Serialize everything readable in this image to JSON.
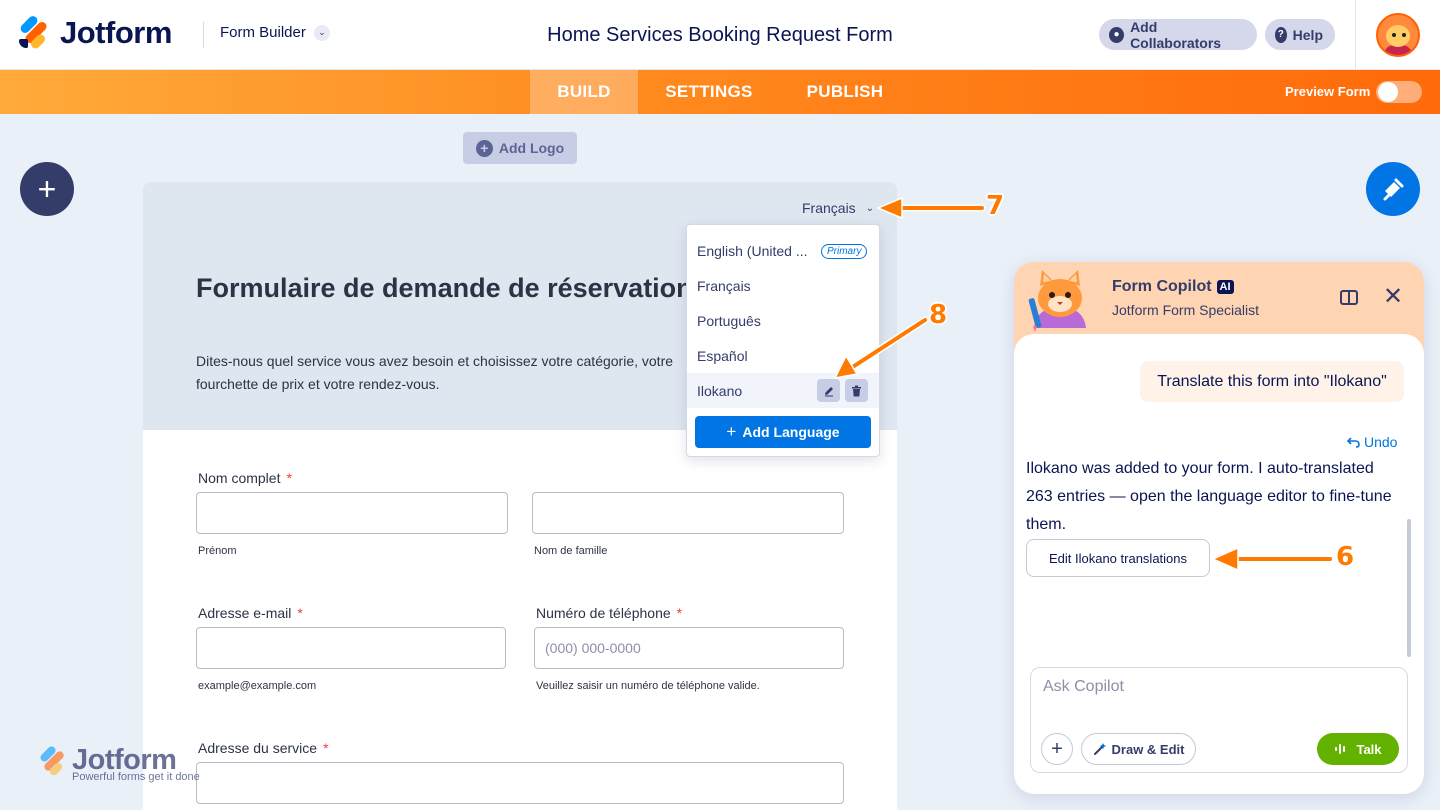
{
  "header": {
    "brand": "Jotform",
    "section": "Form Builder",
    "form_title": "Home Services Booking Request Form",
    "add_collaborators": "Add Collaborators",
    "help": "Help"
  },
  "nav": {
    "tabs": [
      "BUILD",
      "SETTINGS",
      "PUBLISH"
    ],
    "active_tab": "BUILD",
    "preview_label": "Preview Form",
    "preview_on": false
  },
  "canvas": {
    "add_logo": "Add Logo",
    "add_element_icon": "plus-icon",
    "designer_icon": "paint-roller-icon"
  },
  "form": {
    "language_selected": "Français",
    "title": "Formulaire de demande de réservation de services à domicile",
    "subtitle": "Dites-nous quel service vous avez besoin et choisissez votre catégorie, votre fourchette de prix et votre rendez-vous.",
    "fields": {
      "full_name": {
        "label": "Nom complet",
        "required": "*",
        "first_hint": "Prénom",
        "last_hint": "Nom de famille"
      },
      "email": {
        "label": "Adresse e-mail",
        "required": "*",
        "hint": "example@example.com"
      },
      "phone": {
        "label": "Numéro de téléphone",
        "required": "*",
        "placeholder": "(000) 000-0000",
        "hint": "Veuillez saisir un numéro de téléphone valide."
      },
      "address": {
        "label": "Adresse du service",
        "required": "*"
      }
    }
  },
  "language_menu": {
    "items": [
      {
        "label": "English (United ...",
        "badge": "Primary"
      },
      {
        "label": "Français"
      },
      {
        "label": "Português"
      },
      {
        "label": "Español"
      },
      {
        "label": "Ilokano"
      }
    ],
    "add_language": "Add Language"
  },
  "copilot": {
    "title": "Form Copilot",
    "ai_badge": "AI",
    "subtitle": "Jotform Form Specialist",
    "user_message": "Translate this form into \"Ilokano\"",
    "undo": "Undo",
    "bot_message": "Ilokano was added to your form. I auto-translated 263 entries — open the language editor to fine-tune them.",
    "action_button": "Edit Ilokano translations",
    "input_placeholder": "Ask Copilot",
    "draw_edit": "Draw & Edit",
    "talk": "Talk"
  },
  "annotations": [
    "6",
    "7",
    "8"
  ],
  "watermark": {
    "brand": "Jotform",
    "tagline": "Powerful forms get it done"
  },
  "colors": {
    "brand_orange": "#ff6100",
    "primary_blue": "#0075e3",
    "navy": "#0a1551",
    "talk_green": "#64b200",
    "annotation_orange": "#ff7a00"
  }
}
